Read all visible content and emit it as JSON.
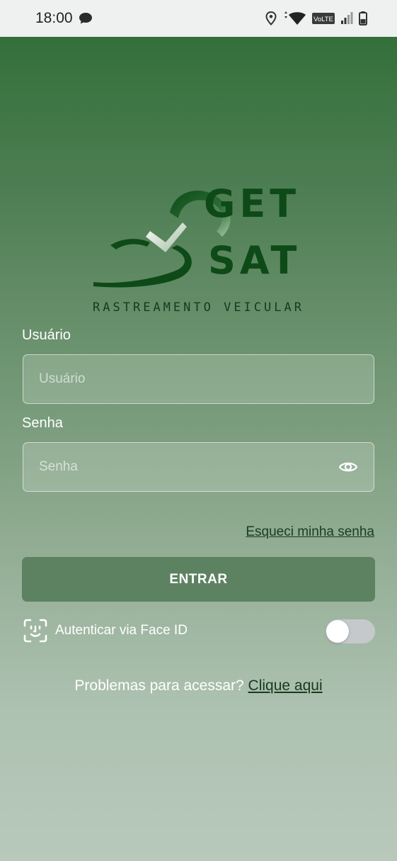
{
  "status_bar": {
    "time": "18:00",
    "icons": [
      "chat-bubble-icon",
      "location-pin-icon",
      "wifi-icon",
      "volte-icon",
      "signal-icon",
      "battery-icon"
    ],
    "volte_label": "VoLTE"
  },
  "brand": {
    "logo_line1": "GET",
    "logo_line2": "SAT",
    "tagline": "RASTREAMENTO VEICULAR",
    "colors": {
      "dark_green": "#0d4a17",
      "accent": "#5d8261"
    }
  },
  "form": {
    "username_label": "Usuário",
    "username_placeholder": "Usuário",
    "username_value": "",
    "password_label": "Senha",
    "password_placeholder": "Senha",
    "password_value": "",
    "forgot_link": "Esqueci minha senha",
    "submit_label": "ENTRAR",
    "faceid_label": "Autenticar via Face ID",
    "faceid_enabled": false
  },
  "footer": {
    "problems_text": "Problemas para acessar?",
    "problems_link": "Clique aqui"
  }
}
